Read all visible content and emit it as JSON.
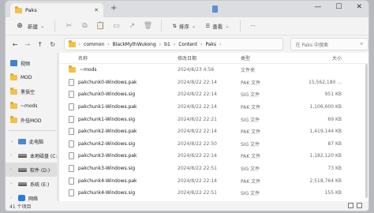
{
  "window": {
    "tab_title": "Paks",
    "new_tab_glyph": "+",
    "close_glyph": "✕",
    "controls": {
      "minimize": "—",
      "maximize": "☐",
      "close": "✕"
    }
  },
  "toolbar": {
    "new_label": "新建",
    "sort_label": "排序",
    "view_label": "查看",
    "more_label": "···"
  },
  "address": {
    "crumbs": [
      "common",
      "BlackMythWukong",
      "b1",
      "Content",
      "Paks"
    ],
    "search_placeholder": "在 Paks 中搜索"
  },
  "sidebar": {
    "items": [
      {
        "label": "视频",
        "icon": "video-icon"
      },
      {
        "label": "MOD",
        "icon": "folder-icon"
      },
      {
        "label": "黑悟空",
        "icon": "folder-icon"
      },
      {
        "label": "~mods",
        "icon": "folder-icon"
      },
      {
        "label": "外挂MOD",
        "icon": "folder-icon"
      },
      {
        "label": "此电脑",
        "icon": "pc-icon"
      },
      {
        "label": "本地磁盘 (C:)",
        "icon": "drive-icon"
      },
      {
        "label": "软件 (D:)",
        "icon": "drive-icon"
      },
      {
        "label": "系统 (E:)",
        "icon": "drive-icon"
      },
      {
        "label": "网络",
        "icon": "network-icon"
      }
    ]
  },
  "columns": {
    "name": "名称",
    "date": "修改日期",
    "type": "类型",
    "size": "大小"
  },
  "files": [
    {
      "name": "~mods",
      "date": "2024/8/23 4:56",
      "type": "文件夹",
      "size": "",
      "kind": "folder"
    },
    {
      "name": "pakchunk0-Windows.pak",
      "date": "2024/8/22 22:14",
      "type": "PAK 文件",
      "size": "15,562,180 ...",
      "kind": "file"
    },
    {
      "name": "pakchunk0-Windows.sig",
      "date": "2024/8/22 22:14",
      "type": "SIG 文件",
      "size": "951 KB",
      "kind": "file"
    },
    {
      "name": "pakchunk1-Windows.pak",
      "date": "2024/8/22 22:14",
      "type": "PAK 文件",
      "size": "1,106,600 KB",
      "kind": "file"
    },
    {
      "name": "pakchunk1-Windows.sig",
      "date": "2024/8/22 22:21",
      "type": "SIG 文件",
      "size": "69 KB",
      "kind": "file"
    },
    {
      "name": "pakchunk2-Windows.pak",
      "date": "2024/8/22 22:14",
      "type": "PAK 文件",
      "size": "1,419,144 KB",
      "kind": "file"
    },
    {
      "name": "pakchunk2-Windows.sig",
      "date": "2024/8/22 22:50",
      "type": "SIG 文件",
      "size": "87 KB",
      "kind": "file"
    },
    {
      "name": "pakchunk3-Windows.pak",
      "date": "2024/8/22 22:14",
      "type": "PAK 文件",
      "size": "1,182,120 KB",
      "kind": "file"
    },
    {
      "name": "pakchunk3-Windows.sig",
      "date": "2024/8/22 22:51",
      "type": "SIG 文件",
      "size": "73 KB",
      "kind": "file"
    },
    {
      "name": "pakchunk4-Windows.pak",
      "date": "2024/8/22 22:14",
      "type": "PAK 文件",
      "size": "2,518,764 KB",
      "kind": "file"
    },
    {
      "name": "pakchunk4-Windows.sig",
      "date": "2024/8/22 22:51",
      "type": "SIG 文件",
      "size": "155 KB",
      "kind": "file"
    }
  ],
  "status": {
    "count": "41 个项目"
  }
}
